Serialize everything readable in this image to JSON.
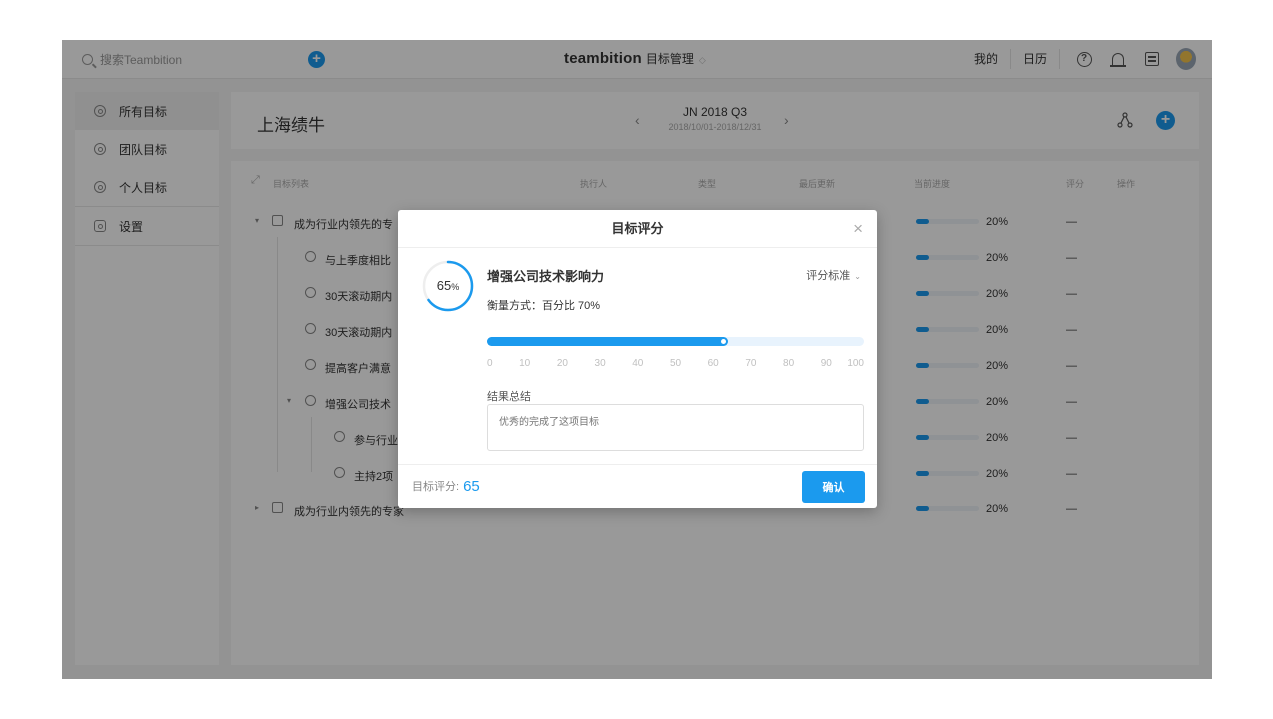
{
  "topbar": {
    "search_placeholder": "搜索Teambition",
    "add_symbol": "+",
    "brand": "teambition",
    "module": "目标管理",
    "module_chevron": "◇",
    "mine": "我的",
    "calendar": "日历",
    "help_symbol": "?"
  },
  "sidebar": {
    "items": [
      {
        "label": "所有目标"
      },
      {
        "label": "团队目标"
      },
      {
        "label": "个人目标"
      },
      {
        "label": "设置"
      }
    ]
  },
  "header": {
    "title": "上海绩牛",
    "period": "JN 2018 Q3",
    "range": "2018/10/01-2018/12/31",
    "prev": "‹",
    "next": "›",
    "add_symbol": "+"
  },
  "list": {
    "columns": {
      "name": "目标列表",
      "owner": "执行人",
      "type": "类型",
      "updated": "最后更新",
      "progress": "当前进度",
      "score": "评分",
      "actions": "操作"
    },
    "expand_icon": "⤢",
    "rows": [
      {
        "name": "成为行业内领先的专",
        "progress": 0.2,
        "progress_label": "20%",
        "score": "—",
        "caret": "▾"
      },
      {
        "name": "与上季度相比",
        "progress": 0.2,
        "progress_label": "20%",
        "score": "—"
      },
      {
        "name": "30天滚动期内",
        "progress": 0.2,
        "progress_label": "20%",
        "score": "—"
      },
      {
        "name": "30天滚动期内",
        "progress": 0.2,
        "progress_label": "20%",
        "score": "—"
      },
      {
        "name": "提高客户满意",
        "progress": 0.2,
        "progress_label": "20%",
        "score": "—"
      },
      {
        "name": "增强公司技术",
        "progress": 0.2,
        "progress_label": "20%",
        "score": "—",
        "caret": "▾"
      },
      {
        "name": "参与行业",
        "progress": 0.2,
        "progress_label": "20%",
        "score": "—"
      },
      {
        "name": "主持2项",
        "progress": 0.2,
        "progress_label": "20%",
        "score": "—"
      },
      {
        "name": "成为行业内领先的专家",
        "progress": 0.2,
        "progress_label": "20%",
        "score": "—",
        "caret": "▸"
      }
    ]
  },
  "modal": {
    "title": "目标评分",
    "close_symbol": "×",
    "ring_value": "65",
    "ring_unit": "%",
    "ring_fraction": 0.65,
    "kr_title": "增强公司技术影响力",
    "scoring_standard": "评分标准",
    "scoring_chevron": "⌄",
    "measure": "衡量方式：百分比   70%",
    "slider_value": 0.64,
    "ticks": [
      "0",
      "10",
      "20",
      "30",
      "40",
      "50",
      "60",
      "70",
      "80",
      "90",
      "100"
    ],
    "summary_label": "结果总结",
    "summary_placeholder": "优秀的完成了这项目标",
    "score_label": "目标评分:",
    "score_value": "65",
    "confirm_label": "确认"
  },
  "colors": {
    "accent": "#1b9aee",
    "overlay": "rgba(0,0,0,0.40)"
  }
}
